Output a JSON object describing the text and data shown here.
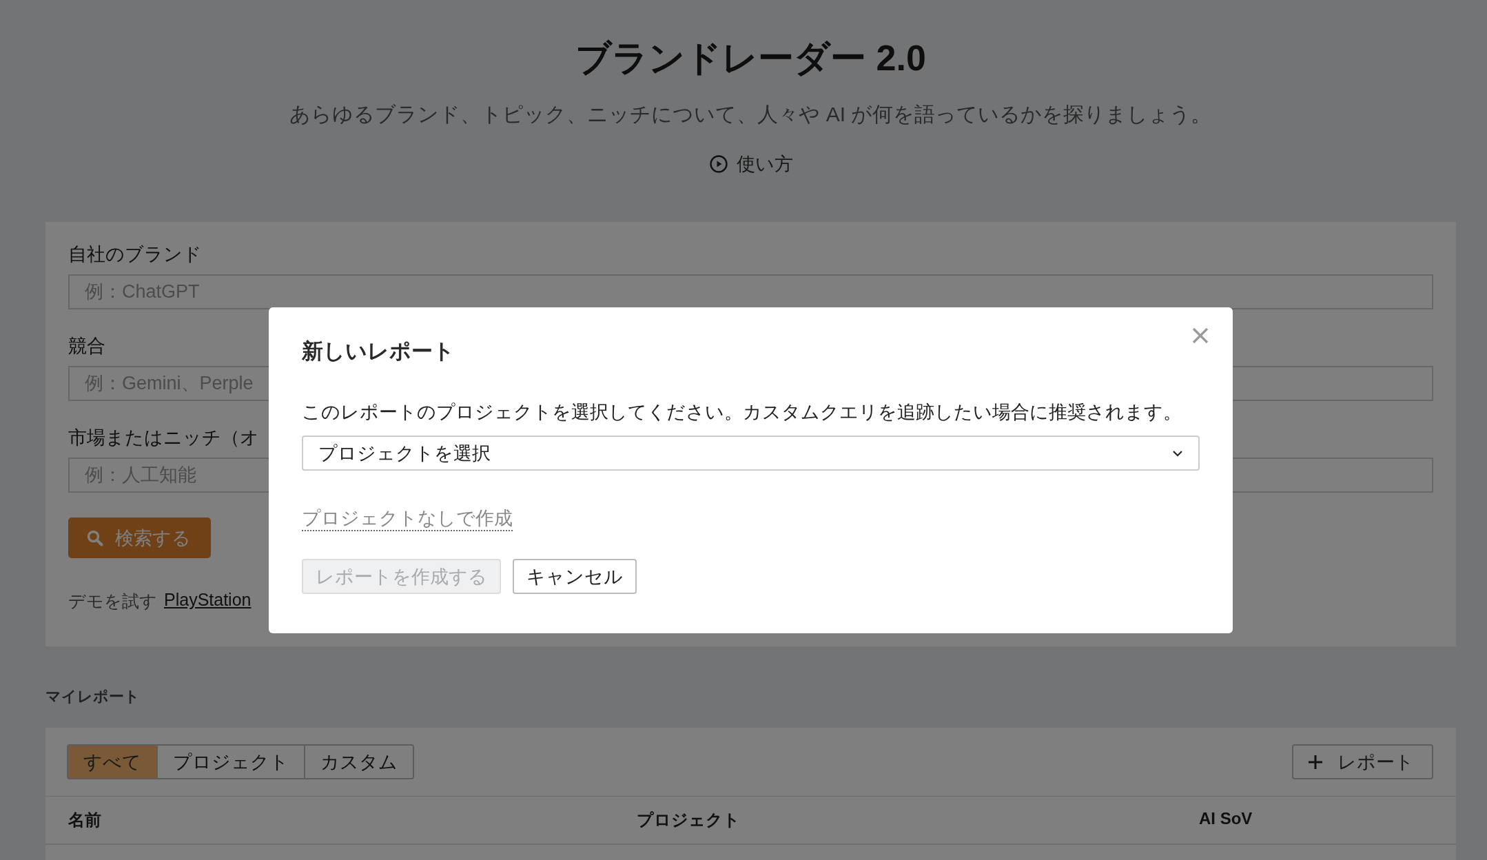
{
  "page": {
    "title": "ブランドレーダー 2.0",
    "subtitle": "あらゆるブランド、トピック、ニッチについて、人々や AI が何を語っているかを探りましょう。",
    "howto": "使い方"
  },
  "form": {
    "fields": [
      {
        "label": "自社のブランド",
        "placeholder": "例：ChatGPT"
      },
      {
        "label": "競合",
        "placeholder": "例：Gemini、Perple"
      },
      {
        "label": "市場またはニッチ（オ",
        "placeholder": "例：人工知能"
      }
    ],
    "search_button": "検索する",
    "demo": {
      "prefix": "デモを試す",
      "link": "PlayStation"
    }
  },
  "reports": {
    "heading": "マイレポート",
    "tabs": [
      {
        "label": "すべて",
        "selected": true
      },
      {
        "label": "プロジェクト",
        "selected": false
      },
      {
        "label": "カスタム",
        "selected": false
      }
    ],
    "add_button": "レポート",
    "columns": [
      "名前",
      "プロジェクト",
      "AI SoV"
    ]
  },
  "modal": {
    "title": "新しいレポート",
    "description": "このレポートのプロジェクトを選択してください。カスタムクエリを追跡したい場合に推奨されます。",
    "select": {
      "value": "プロジェクトを選択"
    },
    "link": "プロジェクトなしで作成",
    "buttons": [
      {
        "label": "レポートを作成する",
        "disabled": true
      },
      {
        "label": "キャンセル",
        "disabled": false
      }
    ]
  }
}
